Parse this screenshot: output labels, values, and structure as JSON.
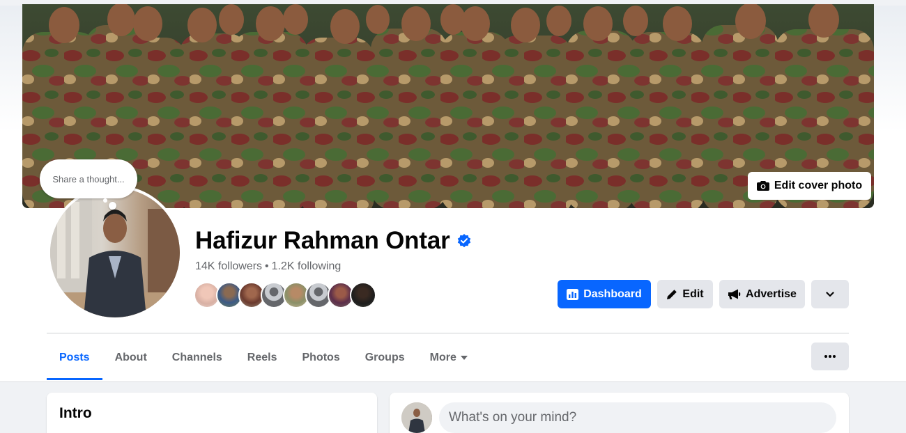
{
  "cover": {
    "edit_button_label": "Edit cover photo",
    "camera_icon": "camera-icon"
  },
  "avatar": {
    "thought_bubble": "Share a thought..."
  },
  "profile": {
    "name": "Hafizur Rahman Ontar",
    "verified_icon": "verified-badge-icon",
    "followers": "14K followers",
    "separator": "•",
    "following": "1.2K following",
    "friend_avatars_count": 8
  },
  "actions": {
    "dashboard_label": "Dashboard",
    "edit_label": "Edit",
    "advertise_label": "Advertise",
    "more_icon": "chevron-down-icon"
  },
  "tabs": [
    {
      "label": "Posts",
      "active": true
    },
    {
      "label": "About",
      "active": false
    },
    {
      "label": "Channels",
      "active": false
    },
    {
      "label": "Reels",
      "active": false
    },
    {
      "label": "Photos",
      "active": false
    },
    {
      "label": "Groups",
      "active": false
    },
    {
      "label": "More",
      "active": false,
      "dropdown": true
    }
  ],
  "intro": {
    "title": "Intro"
  },
  "composer": {
    "placeholder": "What's on your mind?"
  },
  "colors": {
    "accent": "#0866ff",
    "button_gray": "#e4e6eb",
    "secondary_text": "#65676b",
    "page_bg": "#f0f2f5"
  }
}
